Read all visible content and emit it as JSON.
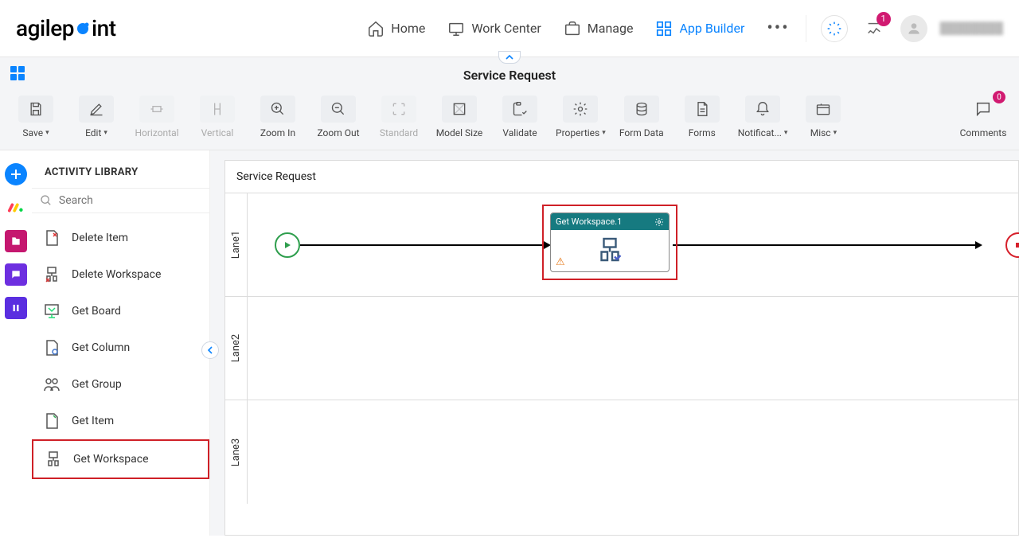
{
  "brand": {
    "text_a": "agilep",
    "text_b": "int"
  },
  "nav": {
    "home": "Home",
    "work_center": "Work Center",
    "manage": "Manage",
    "app_builder": "App Builder"
  },
  "notifications_badge": "1",
  "page_title": "Service Request",
  "toolbar": {
    "save": "Save",
    "edit": "Edit",
    "horizontal": "Horizontal",
    "vertical": "Vertical",
    "zoom_in": "Zoom In",
    "zoom_out": "Zoom Out",
    "standard": "Standard",
    "model_size": "Model Size",
    "validate": "Validate",
    "properties": "Properties",
    "form_data": "Form Data",
    "forms": "Forms",
    "notifications": "Notificat...",
    "misc": "Misc",
    "comments": "Comments",
    "comments_badge": "0"
  },
  "sidebar": {
    "title": "ACTIVITY LIBRARY",
    "search_placeholder": "Search",
    "items": [
      {
        "label": "Delete Item"
      },
      {
        "label": "Delete Workspace"
      },
      {
        "label": "Get Board"
      },
      {
        "label": "Get Column"
      },
      {
        "label": "Get Group"
      },
      {
        "label": "Get Item"
      },
      {
        "label": "Get Workspace"
      }
    ]
  },
  "canvas": {
    "title": "Service Request",
    "lanes": [
      "Lane1",
      "Lane2",
      "Lane3"
    ],
    "activity": {
      "title": "Get Workspace.1"
    }
  }
}
